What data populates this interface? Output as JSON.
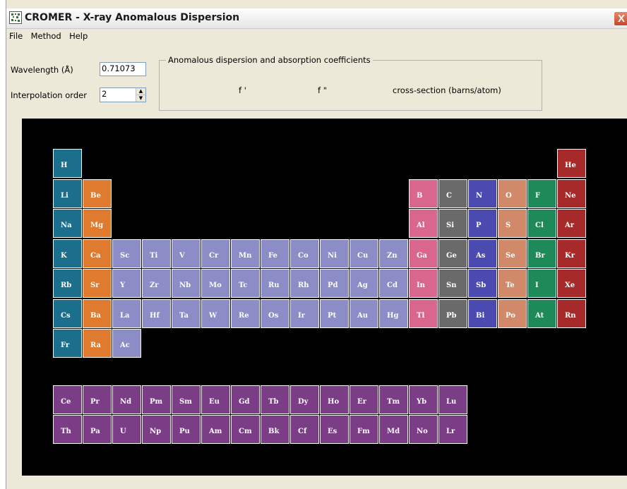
{
  "window": {
    "title": "CROMER - X-ray Anomalous Dispersion",
    "close_glyph": "X"
  },
  "menu": [
    "File",
    "Method",
    "Help"
  ],
  "controls": {
    "wavelength_label": "Wavelength (Å)",
    "wavelength_value": "0.71073",
    "interp_label": "Interpolation order",
    "interp_value": "2"
  },
  "coefficients": {
    "group_title": "Anomalous dispersion and absorption coefficients",
    "f_prime": "f '",
    "f_double_prime": "f \"",
    "cross_section": "cross-section (barns/atom)"
  },
  "colors": {
    "alkali": "#1b6f8c",
    "alkaline_earth": "#e07a2f",
    "transition": "#8c8cc6",
    "post_transition": "#d9668c",
    "metalloid": "#6a6a6a",
    "nonmetal": "#4a4ab0",
    "chalcogen": "#d08a6a",
    "halogen": "#1e8a5a",
    "noble_gas": "#a62a2a",
    "f_block": "#7a3d86"
  },
  "elements": [
    {
      "sym": "H",
      "row": 0,
      "col": 0,
      "cat": "alkali"
    },
    {
      "sym": "He",
      "row": 0,
      "col": 17,
      "cat": "noble_gas"
    },
    {
      "sym": "Li",
      "row": 1,
      "col": 0,
      "cat": "alkali"
    },
    {
      "sym": "Be",
      "row": 1,
      "col": 1,
      "cat": "alkaline_earth"
    },
    {
      "sym": "B",
      "row": 1,
      "col": 12,
      "cat": "post_transition"
    },
    {
      "sym": "C",
      "row": 1,
      "col": 13,
      "cat": "metalloid"
    },
    {
      "sym": "N",
      "row": 1,
      "col": 14,
      "cat": "nonmetal"
    },
    {
      "sym": "O",
      "row": 1,
      "col": 15,
      "cat": "chalcogen"
    },
    {
      "sym": "F",
      "row": 1,
      "col": 16,
      "cat": "halogen"
    },
    {
      "sym": "Ne",
      "row": 1,
      "col": 17,
      "cat": "noble_gas"
    },
    {
      "sym": "Na",
      "row": 2,
      "col": 0,
      "cat": "alkali"
    },
    {
      "sym": "Mg",
      "row": 2,
      "col": 1,
      "cat": "alkaline_earth"
    },
    {
      "sym": "Al",
      "row": 2,
      "col": 12,
      "cat": "post_transition"
    },
    {
      "sym": "Si",
      "row": 2,
      "col": 13,
      "cat": "metalloid"
    },
    {
      "sym": "P",
      "row": 2,
      "col": 14,
      "cat": "nonmetal"
    },
    {
      "sym": "S",
      "row": 2,
      "col": 15,
      "cat": "chalcogen"
    },
    {
      "sym": "Cl",
      "row": 2,
      "col": 16,
      "cat": "halogen"
    },
    {
      "sym": "Ar",
      "row": 2,
      "col": 17,
      "cat": "noble_gas"
    },
    {
      "sym": "K",
      "row": 3,
      "col": 0,
      "cat": "alkali"
    },
    {
      "sym": "Ca",
      "row": 3,
      "col": 1,
      "cat": "alkaline_earth"
    },
    {
      "sym": "Sc",
      "row": 3,
      "col": 2,
      "cat": "transition"
    },
    {
      "sym": "Ti",
      "row": 3,
      "col": 3,
      "cat": "transition"
    },
    {
      "sym": "V",
      "row": 3,
      "col": 4,
      "cat": "transition"
    },
    {
      "sym": "Cr",
      "row": 3,
      "col": 5,
      "cat": "transition"
    },
    {
      "sym": "Mn",
      "row": 3,
      "col": 6,
      "cat": "transition"
    },
    {
      "sym": "Fe",
      "row": 3,
      "col": 7,
      "cat": "transition"
    },
    {
      "sym": "Co",
      "row": 3,
      "col": 8,
      "cat": "transition"
    },
    {
      "sym": "Ni",
      "row": 3,
      "col": 9,
      "cat": "transition"
    },
    {
      "sym": "Cu",
      "row": 3,
      "col": 10,
      "cat": "transition"
    },
    {
      "sym": "Zn",
      "row": 3,
      "col": 11,
      "cat": "transition"
    },
    {
      "sym": "Ga",
      "row": 3,
      "col": 12,
      "cat": "post_transition"
    },
    {
      "sym": "Ge",
      "row": 3,
      "col": 13,
      "cat": "metalloid"
    },
    {
      "sym": "As",
      "row": 3,
      "col": 14,
      "cat": "nonmetal"
    },
    {
      "sym": "Se",
      "row": 3,
      "col": 15,
      "cat": "chalcogen"
    },
    {
      "sym": "Br",
      "row": 3,
      "col": 16,
      "cat": "halogen"
    },
    {
      "sym": "Kr",
      "row": 3,
      "col": 17,
      "cat": "noble_gas"
    },
    {
      "sym": "Rb",
      "row": 4,
      "col": 0,
      "cat": "alkali"
    },
    {
      "sym": "Sr",
      "row": 4,
      "col": 1,
      "cat": "alkaline_earth"
    },
    {
      "sym": "Y",
      "row": 4,
      "col": 2,
      "cat": "transition"
    },
    {
      "sym": "Zr",
      "row": 4,
      "col": 3,
      "cat": "transition"
    },
    {
      "sym": "Nb",
      "row": 4,
      "col": 4,
      "cat": "transition"
    },
    {
      "sym": "Mo",
      "row": 4,
      "col": 5,
      "cat": "transition"
    },
    {
      "sym": "Tc",
      "row": 4,
      "col": 6,
      "cat": "transition"
    },
    {
      "sym": "Ru",
      "row": 4,
      "col": 7,
      "cat": "transition"
    },
    {
      "sym": "Rh",
      "row": 4,
      "col": 8,
      "cat": "transition"
    },
    {
      "sym": "Pd",
      "row": 4,
      "col": 9,
      "cat": "transition"
    },
    {
      "sym": "Ag",
      "row": 4,
      "col": 10,
      "cat": "transition"
    },
    {
      "sym": "Cd",
      "row": 4,
      "col": 11,
      "cat": "transition"
    },
    {
      "sym": "In",
      "row": 4,
      "col": 12,
      "cat": "post_transition"
    },
    {
      "sym": "Sn",
      "row": 4,
      "col": 13,
      "cat": "metalloid"
    },
    {
      "sym": "Sb",
      "row": 4,
      "col": 14,
      "cat": "nonmetal"
    },
    {
      "sym": "Te",
      "row": 4,
      "col": 15,
      "cat": "chalcogen"
    },
    {
      "sym": "I",
      "row": 4,
      "col": 16,
      "cat": "halogen"
    },
    {
      "sym": "Xe",
      "row": 4,
      "col": 17,
      "cat": "noble_gas"
    },
    {
      "sym": "Cs",
      "row": 5,
      "col": 0,
      "cat": "alkali"
    },
    {
      "sym": "Ba",
      "row": 5,
      "col": 1,
      "cat": "alkaline_earth"
    },
    {
      "sym": "La",
      "row": 5,
      "col": 2,
      "cat": "transition"
    },
    {
      "sym": "Hf",
      "row": 5,
      "col": 3,
      "cat": "transition"
    },
    {
      "sym": "Ta",
      "row": 5,
      "col": 4,
      "cat": "transition"
    },
    {
      "sym": "W",
      "row": 5,
      "col": 5,
      "cat": "transition"
    },
    {
      "sym": "Re",
      "row": 5,
      "col": 6,
      "cat": "transition"
    },
    {
      "sym": "Os",
      "row": 5,
      "col": 7,
      "cat": "transition"
    },
    {
      "sym": "Ir",
      "row": 5,
      "col": 8,
      "cat": "transition"
    },
    {
      "sym": "Pt",
      "row": 5,
      "col": 9,
      "cat": "transition"
    },
    {
      "sym": "Au",
      "row": 5,
      "col": 10,
      "cat": "transition"
    },
    {
      "sym": "Hg",
      "row": 5,
      "col": 11,
      "cat": "transition"
    },
    {
      "sym": "Tl",
      "row": 5,
      "col": 12,
      "cat": "post_transition"
    },
    {
      "sym": "Pb",
      "row": 5,
      "col": 13,
      "cat": "metalloid"
    },
    {
      "sym": "Bi",
      "row": 5,
      "col": 14,
      "cat": "nonmetal"
    },
    {
      "sym": "Po",
      "row": 5,
      "col": 15,
      "cat": "chalcogen"
    },
    {
      "sym": "At",
      "row": 5,
      "col": 16,
      "cat": "halogen"
    },
    {
      "sym": "Rn",
      "row": 5,
      "col": 17,
      "cat": "noble_gas"
    },
    {
      "sym": "Fr",
      "row": 6,
      "col": 0,
      "cat": "alkali"
    },
    {
      "sym": "Ra",
      "row": 6,
      "col": 1,
      "cat": "alkaline_earth"
    },
    {
      "sym": "Ac",
      "row": 6,
      "col": 2,
      "cat": "transition"
    },
    {
      "sym": "Ce",
      "row": 8,
      "col": 0,
      "cat": "f_block"
    },
    {
      "sym": "Pr",
      "row": 8,
      "col": 1,
      "cat": "f_block"
    },
    {
      "sym": "Nd",
      "row": 8,
      "col": 2,
      "cat": "f_block"
    },
    {
      "sym": "Pm",
      "row": 8,
      "col": 3,
      "cat": "f_block"
    },
    {
      "sym": "Sm",
      "row": 8,
      "col": 4,
      "cat": "f_block"
    },
    {
      "sym": "Eu",
      "row": 8,
      "col": 5,
      "cat": "f_block"
    },
    {
      "sym": "Gd",
      "row": 8,
      "col": 6,
      "cat": "f_block"
    },
    {
      "sym": "Tb",
      "row": 8,
      "col": 7,
      "cat": "f_block"
    },
    {
      "sym": "Dy",
      "row": 8,
      "col": 8,
      "cat": "f_block"
    },
    {
      "sym": "Ho",
      "row": 8,
      "col": 9,
      "cat": "f_block"
    },
    {
      "sym": "Er",
      "row": 8,
      "col": 10,
      "cat": "f_block"
    },
    {
      "sym": "Tm",
      "row": 8,
      "col": 11,
      "cat": "f_block"
    },
    {
      "sym": "Yb",
      "row": 8,
      "col": 12,
      "cat": "f_block"
    },
    {
      "sym": "Lu",
      "row": 8,
      "col": 13,
      "cat": "f_block"
    },
    {
      "sym": "Th",
      "row": 9,
      "col": 0,
      "cat": "f_block"
    },
    {
      "sym": "Pa",
      "row": 9,
      "col": 1,
      "cat": "f_block"
    },
    {
      "sym": "U",
      "row": 9,
      "col": 2,
      "cat": "f_block"
    },
    {
      "sym": "Np",
      "row": 9,
      "col": 3,
      "cat": "f_block"
    },
    {
      "sym": "Pu",
      "row": 9,
      "col": 4,
      "cat": "f_block"
    },
    {
      "sym": "Am",
      "row": 9,
      "col": 5,
      "cat": "f_block"
    },
    {
      "sym": "Cm",
      "row": 9,
      "col": 6,
      "cat": "f_block"
    },
    {
      "sym": "Bk",
      "row": 9,
      "col": 7,
      "cat": "f_block"
    },
    {
      "sym": "Cf",
      "row": 9,
      "col": 8,
      "cat": "f_block"
    },
    {
      "sym": "Es",
      "row": 9,
      "col": 9,
      "cat": "f_block"
    },
    {
      "sym": "Fm",
      "row": 9,
      "col": 10,
      "cat": "f_block"
    },
    {
      "sym": "Md",
      "row": 9,
      "col": 11,
      "cat": "f_block"
    },
    {
      "sym": "No",
      "row": 9,
      "col": 12,
      "cat": "f_block"
    },
    {
      "sym": "Lr",
      "row": 9,
      "col": 13,
      "cat": "f_block"
    }
  ]
}
